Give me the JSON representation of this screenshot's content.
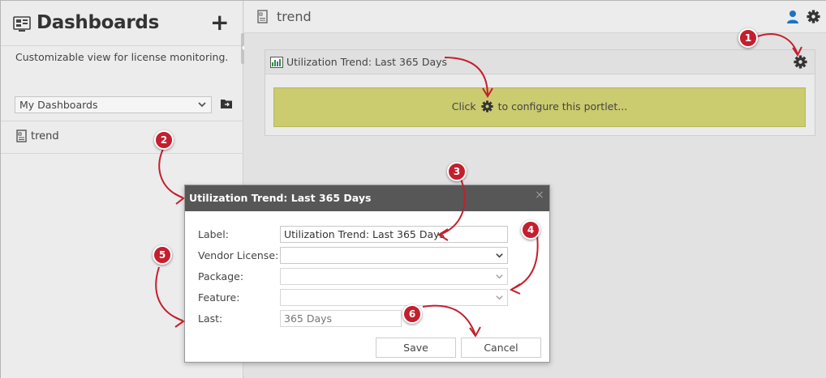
{
  "sidebar": {
    "title": "Dashboards",
    "add_label": "+",
    "description": "Customizable view for license monitoring.",
    "dashboard_select": {
      "value": "My Dashboards"
    },
    "items": [
      {
        "label": "trend"
      }
    ]
  },
  "main": {
    "title": "trend",
    "portlet": {
      "title": "Utilization Trend: Last 365 Days",
      "placeholder_prefix": "Click",
      "placeholder_suffix": "to configure this portlet..."
    }
  },
  "dialog": {
    "title": "Utilization Trend: Last 365 Days",
    "close_label": "×",
    "fields": {
      "label": {
        "label": "Label:",
        "value": "Utilization Trend: Last 365 Days"
      },
      "vendor_license": {
        "label": "Vendor License:",
        "value": ""
      },
      "package": {
        "label": "Package:",
        "value": ""
      },
      "feature": {
        "label": "Feature:",
        "value": ""
      },
      "last": {
        "label": "Last:",
        "value": "365 Days"
      }
    },
    "save_label": "Save",
    "cancel_label": "Cancel"
  },
  "annotations": [
    "1",
    "2",
    "3",
    "4",
    "5",
    "6"
  ],
  "colors": {
    "accent_red": "#c41f2e",
    "placeholder_yellow": "#cbcb6f",
    "dialog_header": "#575757",
    "user_icon": "#1a73c7"
  },
  "icons": [
    "dashboard-icon",
    "plus-icon",
    "folder-icon",
    "document-icon",
    "user-icon",
    "gear-icon",
    "chart-icon",
    "chevron-down-icon",
    "close-icon"
  ]
}
